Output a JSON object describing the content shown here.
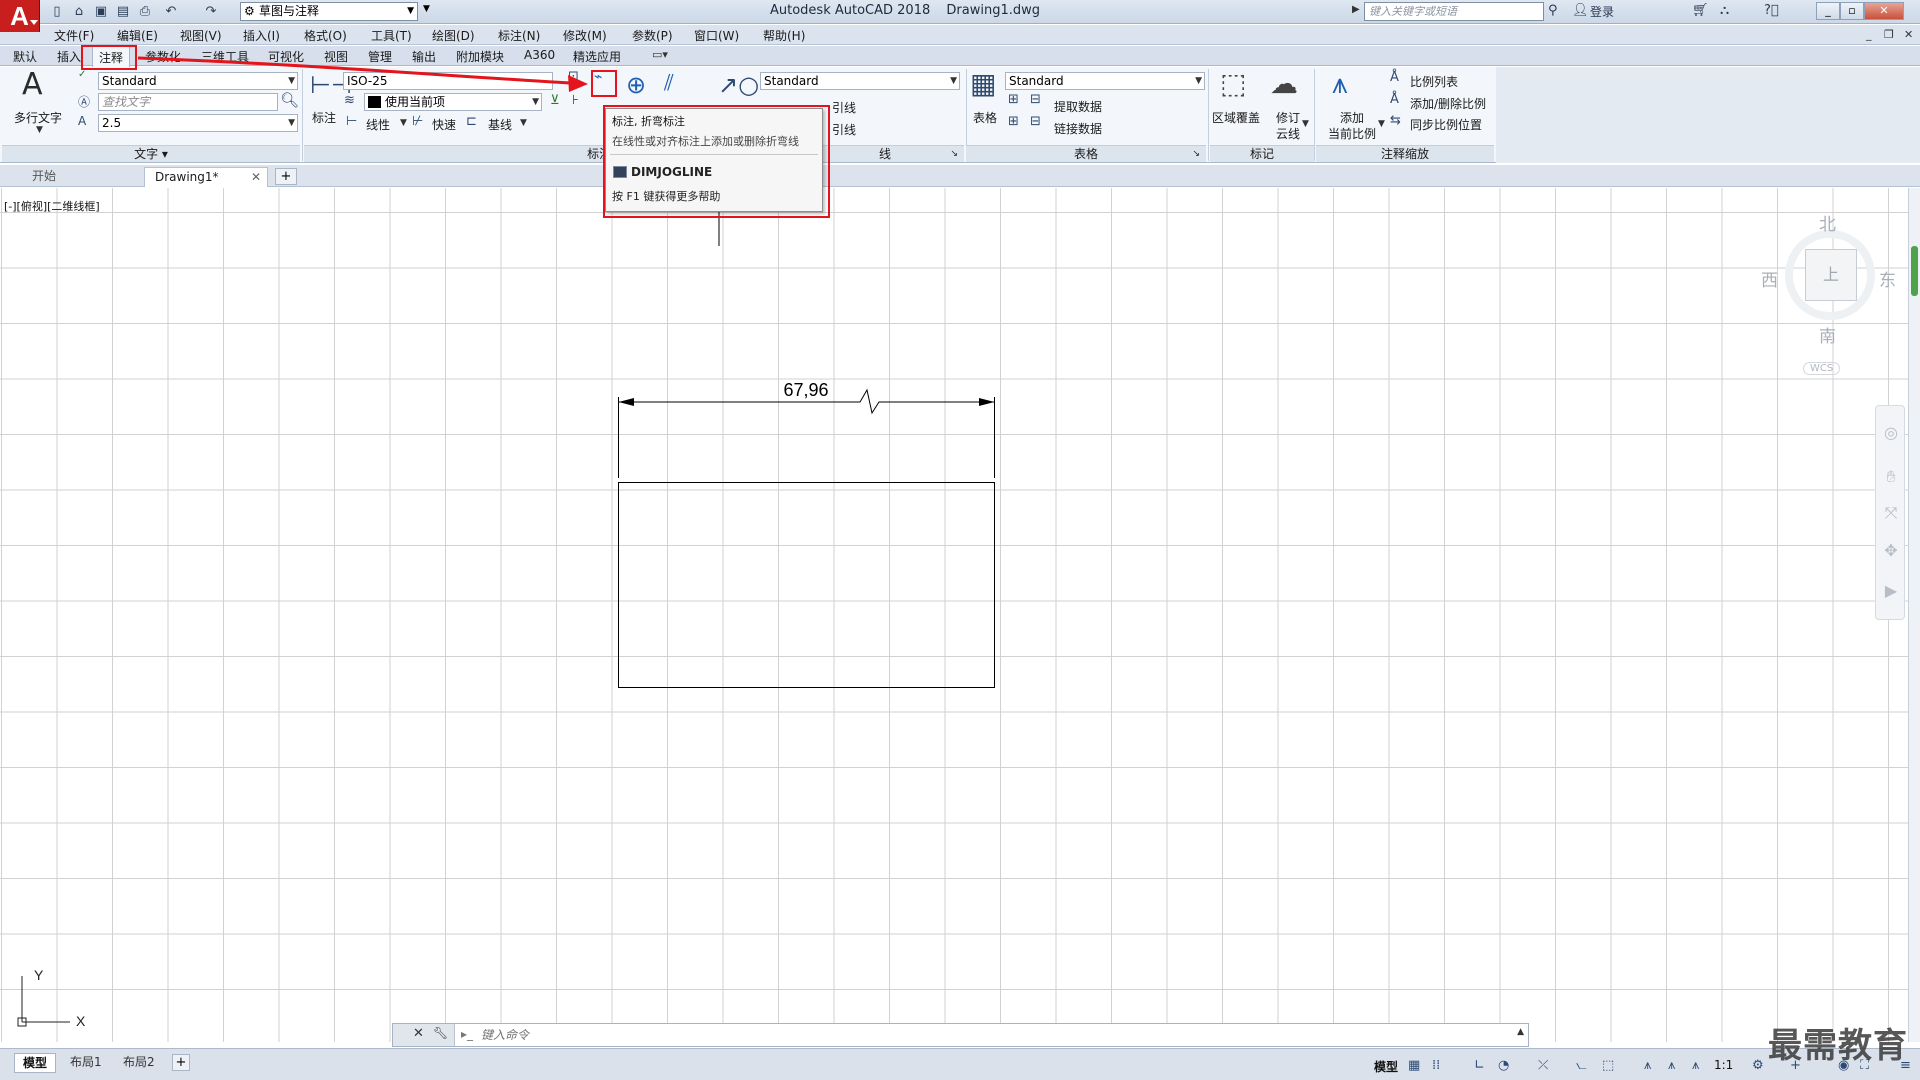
{
  "title_bar": {
    "app_title": "Autodesk AutoCAD 2018",
    "file_name": "Drawing1.dwg",
    "workspace": "草图与注释",
    "search_placeholder": "键入关键字或短语",
    "login": "登录"
  },
  "menu": [
    "文件(F)",
    "编辑(E)",
    "视图(V)",
    "插入(I)",
    "格式(O)",
    "工具(T)",
    "绘图(D)",
    "标注(N)",
    "修改(M)",
    "参数(P)",
    "窗口(W)",
    "帮助(H)"
  ],
  "ribbon_tabs": [
    "默认",
    "插入",
    "注释",
    "参数化",
    "三维工具",
    "可视化",
    "视图",
    "管理",
    "输出",
    "附加模块",
    "A360",
    "精选应用"
  ],
  "active_tab": "注释",
  "ribbon": {
    "text_panel": {
      "title": "文字",
      "mtext_label": "多行文字",
      "style": "Standard",
      "find_placeholder": "查找文字",
      "height": "2.5"
    },
    "dim_panel": {
      "title": "标注",
      "dim_label": "标注",
      "dim_style": "ISO-25",
      "layer": "使用当前项",
      "linear": "线性",
      "quick": "快速",
      "baseline": "基线"
    },
    "leader_panel": {
      "style": "Standard",
      "item1": "引线",
      "item2": "引线",
      "title": "线"
    },
    "table_panel": {
      "title": "表格",
      "table_label": "表格",
      "style": "Standard",
      "extract": "提取数据",
      "link": "链接数据"
    },
    "markup_panel": {
      "title": "标记",
      "wipeout": "区域覆盖",
      "revcloud_1": "修订",
      "revcloud_2": "云线"
    },
    "scale_panel": {
      "title": "注释缩放",
      "add_1": "添加",
      "add_2": "当前比例",
      "scale_list": "比例列表",
      "add_delete": "添加/删除比例",
      "sync": "同步比例位置"
    }
  },
  "file_tabs": {
    "start": "开始",
    "drawing": "Drawing1*"
  },
  "viewport_label": "[-][俯视][二维线框]",
  "tooltip": {
    "title": "标注, 折弯标注",
    "description": "在线性或对齐标注上添加或删除折弯线",
    "command": "DIMJOGLINE",
    "help": "按 F1 键获得更多帮助"
  },
  "drawing": {
    "dimension_text": "67,96"
  },
  "viewcube": {
    "north": "北",
    "south": "南",
    "east": "东",
    "west": "西",
    "top": "上",
    "wcs": "WCS"
  },
  "ucs": {
    "x": "X",
    "y": "Y"
  },
  "command_line": {
    "placeholder": "键入命令"
  },
  "layout_tabs": [
    "模型",
    "布局1",
    "布局2"
  ],
  "status_bar": {
    "model": "模型",
    "scale": "1:1"
  },
  "watermark": "最需教育",
  "colors": {
    "annotation_red": "#e3141b",
    "grid": "#d2d2d2",
    "logo_red": "#c81e1e"
  }
}
